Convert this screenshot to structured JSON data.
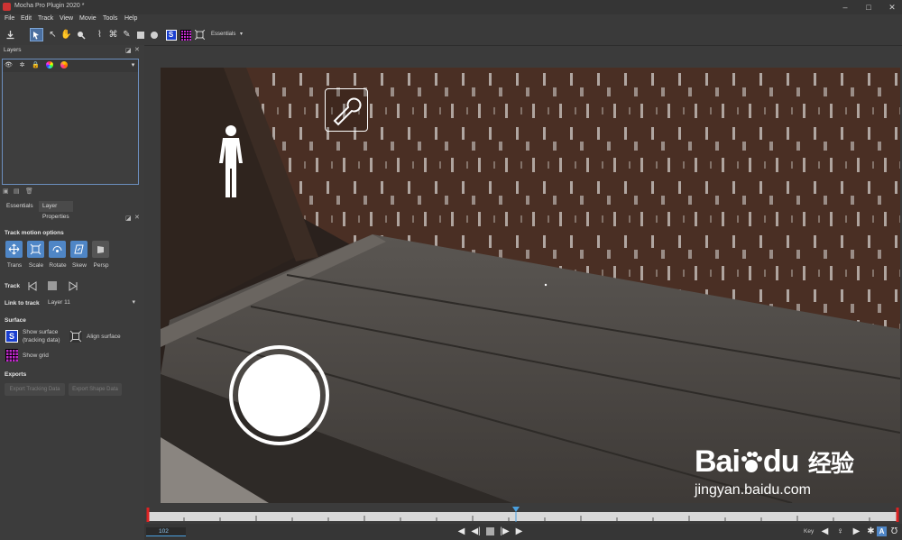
{
  "window": {
    "title": "Mocha Pro Plugin 2020 *",
    "minimize": "–",
    "maximize": "□",
    "close": "✕"
  },
  "menu": [
    "File",
    "Edit",
    "Track",
    "View",
    "Movie",
    "Tools",
    "Help"
  ],
  "toolbar": {
    "workspace": "Essentials"
  },
  "layers_panel": {
    "title": "Layers"
  },
  "tabs": [
    "Essentials",
    "Layer Properties"
  ],
  "track_motion": {
    "title": "Track motion options",
    "options": [
      {
        "label": "Trans",
        "icon": "trans-icon",
        "color": "#4f86c6"
      },
      {
        "label": "Scale",
        "icon": "scale-icon",
        "color": "#4f86c6"
      },
      {
        "label": "Rotate",
        "icon": "rotate-icon",
        "color": "#4f86c6"
      },
      {
        "label": "Skew",
        "icon": "skew-icon",
        "color": "#4f86c6"
      },
      {
        "label": "Persp",
        "icon": "persp-icon",
        "color": "#555555"
      }
    ]
  },
  "track": {
    "title": "Track"
  },
  "link_to_track": {
    "label": "Link to track",
    "value": "Layer 11"
  },
  "surface": {
    "title": "Surface",
    "show_surface_line1": "Show surface",
    "show_surface_line2": "(tracking data)",
    "align_surface": "Align surface",
    "show_grid": "Show grid"
  },
  "exports": {
    "title": "Exports",
    "export_tracking": "Export Tracking Data",
    "export_shape": "Export Shape Data"
  },
  "timeline": {
    "current_frame": "102"
  },
  "transport": {
    "key_label": "Key"
  },
  "watermark": {
    "brand": "Bai",
    "brand2": "du",
    "cn": "经验",
    "url": "jingyan.baidu.com"
  }
}
